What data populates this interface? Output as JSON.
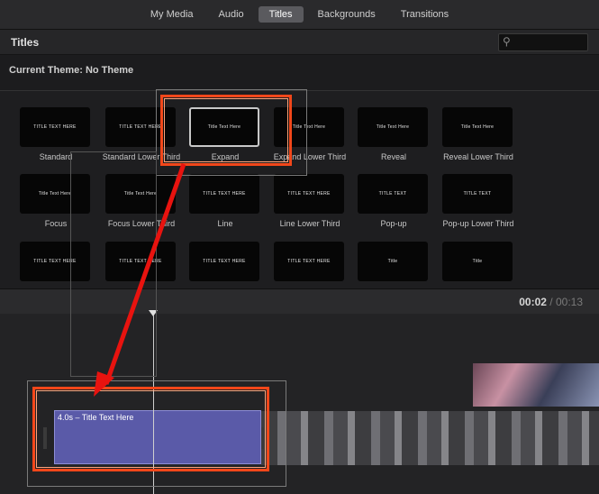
{
  "tabs": [
    {
      "label": "My Media",
      "active": false
    },
    {
      "label": "Audio",
      "active": false
    },
    {
      "label": "Titles",
      "active": true
    },
    {
      "label": "Backgrounds",
      "active": false
    },
    {
      "label": "Transitions",
      "active": false
    }
  ],
  "browser_header": {
    "title": "Titles",
    "search_placeholder": "",
    "search_icon": "search-icon"
  },
  "theme_label": "Current Theme: No Theme",
  "title_styles": [
    {
      "name": "Standard",
      "preview": "TITLE TEXT HERE"
    },
    {
      "name": "Standard Lower Third",
      "preview": "TITLE TEXT HERE"
    },
    {
      "name": "Expand",
      "preview": "Title Text Here"
    },
    {
      "name": "Expand Lower Third",
      "preview": "Title Text Here"
    },
    {
      "name": "Reveal",
      "preview": "Title Text Here"
    },
    {
      "name": "Reveal Lower Third",
      "preview": "Title Text Here"
    },
    {
      "name": "Focus",
      "preview": "Title Text Here"
    },
    {
      "name": "Focus Lower Third",
      "preview": "Title Text Here"
    },
    {
      "name": "Line",
      "preview": "TITLE TEXT HERE"
    },
    {
      "name": "Line Lower Third",
      "preview": "TITLE TEXT HERE"
    },
    {
      "name": "Pop-up",
      "preview": "TITLE TEXT"
    },
    {
      "name": "Pop-up Lower Third",
      "preview": "TITLE TEXT"
    },
    {
      "name": "",
      "preview": "TITLE TEXT HERE"
    },
    {
      "name": "",
      "preview": "TITLE TEXT HERE"
    },
    {
      "name": "",
      "preview": "TITLE TEXT HERE"
    },
    {
      "name": "",
      "preview": "TITLE TEXT HERE"
    },
    {
      "name": "",
      "preview": "Title"
    },
    {
      "name": "",
      "preview": "Title"
    }
  ],
  "timecode": {
    "current": "00:02",
    "separator": " / ",
    "total": "00:13"
  },
  "title_clip": {
    "label": "4.0s – Title Text Here"
  },
  "colors": {
    "accent_highlight": "#f2471a",
    "arrow": "#e8130f",
    "title_clip": "#5a5aa8",
    "active_tab": "#5a5a5e"
  }
}
